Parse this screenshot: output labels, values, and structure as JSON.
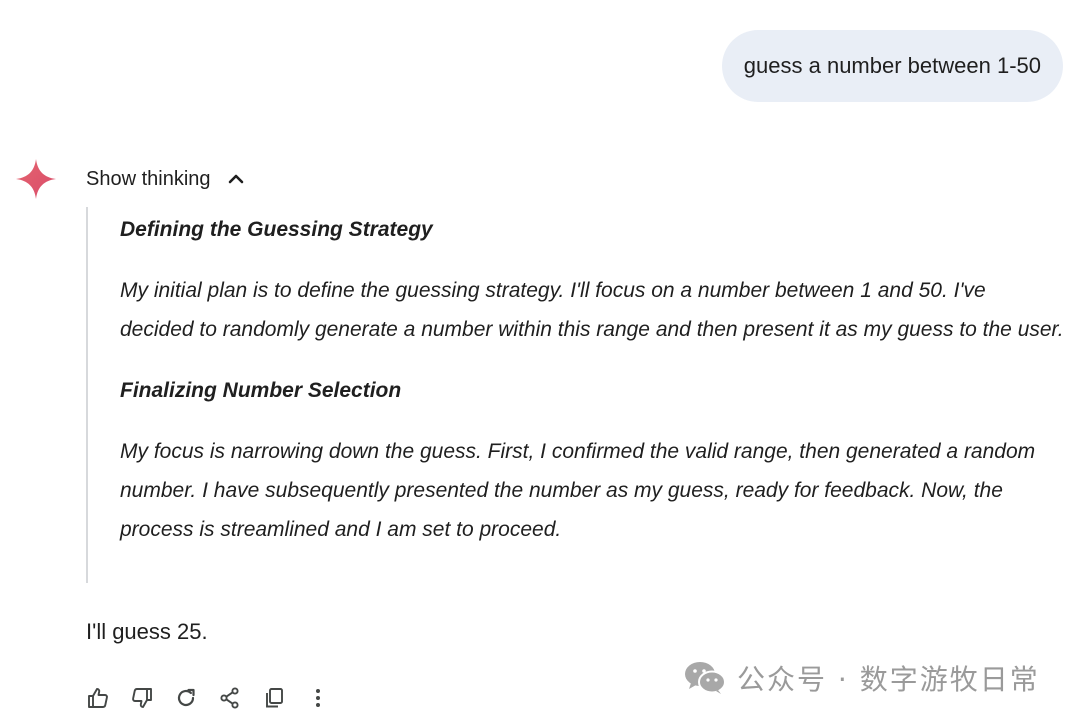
{
  "user_message": {
    "text": "guess a number between 1-50"
  },
  "thinking": {
    "toggle_label": "Show thinking",
    "sections": [
      {
        "heading": "Defining the Guessing Strategy",
        "body": "My initial plan is to define the guessing strategy. I'll focus on a number between 1 and 50. I've decided to randomly generate a number within this range and then present it as my guess to the user."
      },
      {
        "heading": "Finalizing Number Selection",
        "body": "My focus is narrowing down the guess. First, I confirmed the valid range, then generated a random number. I have subsequently presented the number as my guess, ready for feedback. Now, the process is streamlined and I am set to proceed."
      }
    ]
  },
  "response": {
    "text": "I'll guess 25."
  },
  "actions": [
    {
      "icon": "thumbs-up-icon"
    },
    {
      "icon": "thumbs-down-icon"
    },
    {
      "icon": "regenerate-icon"
    },
    {
      "icon": "share-icon"
    },
    {
      "icon": "copy-icon"
    },
    {
      "icon": "more-vert-icon"
    }
  ],
  "watermark": {
    "text": "公众号 · 数字游牧日常"
  },
  "colors": {
    "user_bubble_bg": "#e9eef6",
    "rail": "#d7d9dc",
    "text": "#1f1f1f",
    "watermark": "#9a9a9a"
  }
}
